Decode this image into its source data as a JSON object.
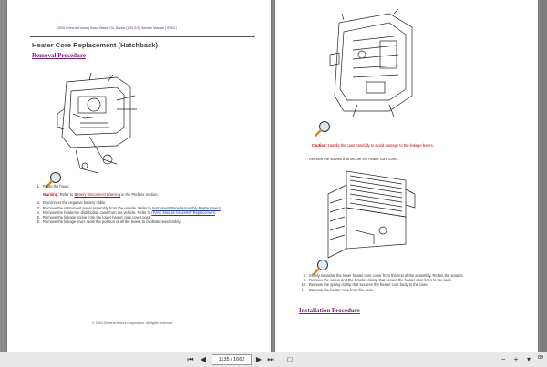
{
  "header": {
    "doc": "2005 Chevrolet Aveo",
    "sep": " | ",
    "rest": "Aveo, Wave, G3, Barina (U/N G/T) Service Manual | HVAC |"
  },
  "title": "Heater Core Replacement (Hatchback)",
  "removal_heading": "Removal Procedure",
  "installation_heading": "Installation Procedure",
  "steps_left": [
    {
      "n": "1.",
      "text": "Raise the hood."
    },
    {
      "n": "2.",
      "text": "Disconnect the negative battery cable."
    },
    {
      "n": "3.",
      "text": "Remove the instrument panel assembly from the vehicle. Refer to ",
      "link": "Instrument Panel Assembly Replacement",
      "after": "."
    },
    {
      "n": "4.",
      "text": "Remove the heater/air distribution case from the vehicle. Refer to ",
      "link": "HVAC Module Assembly Replacement",
      "after": "."
    },
    {
      "n": "5.",
      "text": "Remove the linkage screw from the lower heater core cover post."
    },
    {
      "n": "6.",
      "text": "Remove the linkage lever. Note the position of all the levers to facilitate reassembly."
    }
  ],
  "warning": {
    "label": "Warning:",
    "pre": " Refer to ",
    "link": "Battery Disconnect Warning",
    "post": " in the Preface section."
  },
  "caution": {
    "label": "Caution:",
    "text": " Handle the case carefully to avoid damage to the linkage levers."
  },
  "steps_right_a": [
    {
      "n": "7.",
      "text": "Remove the screws that secure the heater core cover."
    }
  ],
  "steps_right_b": [
    {
      "n": "8.",
      "text": "Slowly separate the lower heater core cover from the rest of the assembly. Retain the sealant."
    },
    {
      "n": "9.",
      "text": "Remove the screw and the bracket clamp that secure the heater core lines to the case."
    },
    {
      "n": "10.",
      "text": "Remove the spring clamp that secures the heater core body to the case."
    },
    {
      "n": "11.",
      "text": "Remove the heater core from the case."
    }
  ],
  "copyright": "© 2010 General Motors Corporation.  All rights reserved.",
  "toolbar": {
    "page": "1135 / 1662",
    "zoom": "89"
  },
  "icons": {
    "magnifier": "magnifier-icon",
    "first": "first-page-icon",
    "prev": "prev-page-icon",
    "next": "next-page-icon",
    "last": "last-page-icon"
  },
  "colors": {
    "accent": "#7a1f7a",
    "warning": "#c00000",
    "link": "#1a3c9a"
  }
}
